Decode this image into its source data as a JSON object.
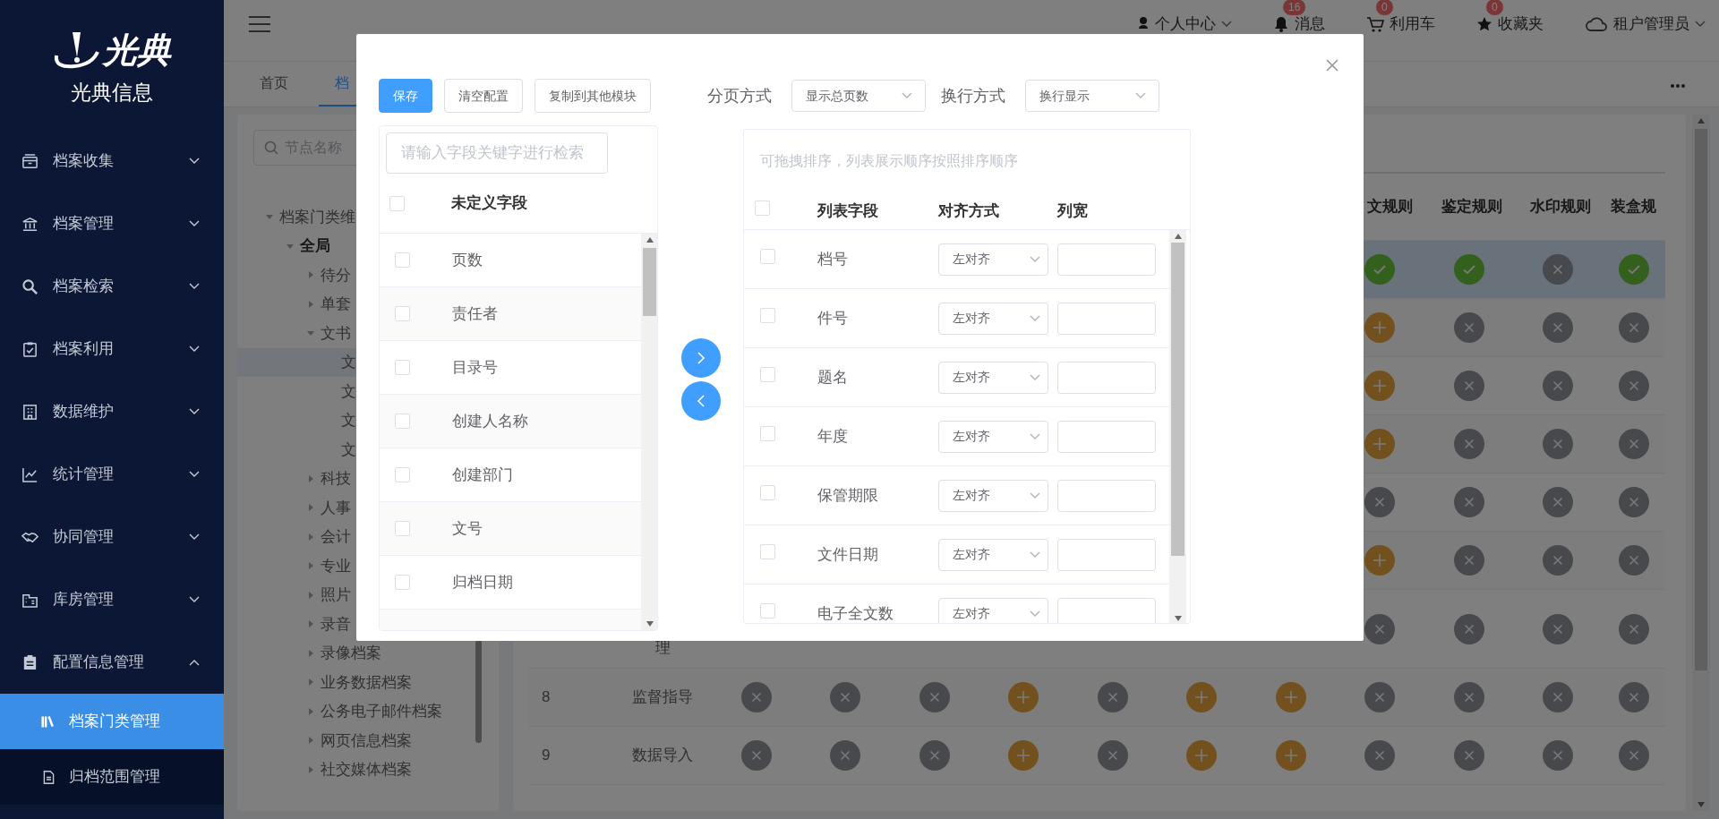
{
  "sidebar": {
    "logo_text": "光典",
    "brand": "光典信息",
    "items": [
      {
        "label": "档案收集",
        "expanded": false
      },
      {
        "label": "档案管理",
        "expanded": false
      },
      {
        "label": "档案检索",
        "expanded": false
      },
      {
        "label": "档案利用",
        "expanded": false
      },
      {
        "label": "数据维护",
        "expanded": false
      },
      {
        "label": "统计管理",
        "expanded": false
      },
      {
        "label": "协同管理",
        "expanded": false
      },
      {
        "label": "库房管理",
        "expanded": false
      },
      {
        "label": "配置信息管理",
        "expanded": true,
        "children": [
          {
            "label": "档案门类管理",
            "selected": true
          },
          {
            "label": "归档范围管理",
            "selected": false
          }
        ]
      }
    ]
  },
  "header": {
    "items": [
      {
        "kind": "dropdown",
        "label": "个人中心"
      },
      {
        "kind": "badge",
        "label": "消息",
        "badge": "16"
      },
      {
        "kind": "badge",
        "label": "利用车",
        "badge": "0"
      },
      {
        "kind": "badge",
        "label": "收藏夹",
        "badge": "0"
      },
      {
        "kind": "dropdown",
        "label": "租户管理员"
      }
    ]
  },
  "tabs": [
    {
      "label": "首页",
      "selected": false
    },
    {
      "label": "档",
      "selected": true
    }
  ],
  "tree": {
    "search_placeholder": "节点名称",
    "nodes": [
      {
        "label": "档案门类维",
        "expanded": true,
        "selected": false,
        "children": [
          {
            "label": "全局",
            "expanded": true,
            "selected": false,
            "children": [
              {
                "label": "待分",
                "expanded": false,
                "selected": false
              },
              {
                "label": "单套",
                "expanded": false,
                "selected": false
              },
              {
                "label": "文书",
                "expanded": true,
                "selected": false,
                "children": [
                  {
                    "label": "文",
                    "selected": true
                  },
                  {
                    "label": "文",
                    "selected": false
                  },
                  {
                    "label": "文",
                    "selected": false
                  },
                  {
                    "label": "文",
                    "selected": false
                  }
                ]
              },
              {
                "label": "科技",
                "expanded": false,
                "selected": false
              },
              {
                "label": "人事",
                "expanded": false,
                "selected": false
              },
              {
                "label": "会计",
                "expanded": false,
                "selected": false
              },
              {
                "label": "专业",
                "expanded": false,
                "selected": false
              },
              {
                "label": "照片",
                "expanded": false,
                "selected": false
              },
              {
                "label": "录音",
                "expanded": false,
                "selected": false
              },
              {
                "label": "录像档案",
                "expanded": false,
                "selected": false
              },
              {
                "label": "业务数据档案",
                "expanded": false,
                "selected": false
              },
              {
                "label": "公务电子邮件档案",
                "expanded": false,
                "selected": false
              },
              {
                "label": "网页信息档案",
                "expanded": false,
                "selected": false
              },
              {
                "label": "社交媒体档案",
                "expanded": false,
                "selected": false
              }
            ]
          }
        ]
      }
    ]
  },
  "table": {
    "columns": [
      null,
      null,
      null,
      null,
      null,
      null,
      null,
      "文规则",
      "鉴定规则",
      "水印规则",
      "装盒规"
    ],
    "rows": [
      {
        "selected": true,
        "cells": [
          null,
          null,
          null,
          null,
          null,
          null,
          null,
          {
            "kind": "check"
          },
          {
            "kind": "check"
          },
          {
            "kind": "cross"
          },
          {
            "kind": "check"
          }
        ]
      },
      {
        "selected": false,
        "cells": [
          null,
          null,
          null,
          null,
          null,
          null,
          null,
          {
            "kind": "plus"
          },
          {
            "kind": "cross"
          },
          {
            "kind": "cross"
          },
          {
            "kind": "cross"
          }
        ]
      },
      {
        "selected": false,
        "cells": [
          null,
          null,
          null,
          null,
          null,
          null,
          null,
          {
            "kind": "plus"
          },
          {
            "kind": "cross"
          },
          {
            "kind": "cross"
          },
          {
            "kind": "cross"
          }
        ]
      },
      {
        "selected": false,
        "cells": [
          null,
          null,
          null,
          null,
          null,
          null,
          null,
          {
            "kind": "plus"
          },
          {
            "kind": "cross"
          },
          {
            "kind": "cross"
          },
          {
            "kind": "cross"
          }
        ]
      },
      {
        "selected": false,
        "cells": [
          null,
          null,
          null,
          null,
          null,
          null,
          null,
          {
            "kind": "cross"
          },
          {
            "kind": "cross"
          },
          {
            "kind": "cross"
          },
          {
            "kind": "cross"
          }
        ]
      },
      {
        "selected": false,
        "cells": [
          null,
          null,
          null,
          null,
          null,
          null,
          null,
          {
            "kind": "plus"
          },
          {
            "kind": "cross"
          },
          {
            "kind": "cross"
          },
          {
            "kind": "cross"
          }
        ]
      },
      {
        "selected": false,
        "name": "理",
        "cells": [
          null,
          null,
          null,
          null,
          null,
          null,
          null,
          {
            "kind": "cross"
          },
          {
            "kind": "cross"
          },
          {
            "kind": "cross"
          },
          {
            "kind": "cross"
          }
        ]
      },
      {
        "selected": false,
        "number": "8",
        "name": "监督指导",
        "cells": [
          {
            "kind": "cross"
          },
          {
            "kind": "cross"
          },
          {
            "kind": "cross"
          },
          {
            "kind": "plus"
          },
          {
            "kind": "cross"
          },
          {
            "kind": "plus"
          },
          {
            "kind": "plus"
          },
          {
            "kind": "cross"
          },
          {
            "kind": "cross"
          },
          {
            "kind": "cross"
          },
          {
            "kind": "cross"
          }
        ]
      },
      {
        "selected": false,
        "number": "9",
        "name": "数据导入",
        "cells": [
          {
            "kind": "cross"
          },
          {
            "kind": "cross"
          },
          {
            "kind": "cross"
          },
          {
            "kind": "plus"
          },
          {
            "kind": "cross"
          },
          {
            "kind": "plus"
          },
          {
            "kind": "plus"
          },
          {
            "kind": "cross"
          },
          {
            "kind": "cross"
          },
          {
            "kind": "cross"
          },
          {
            "kind": "cross"
          }
        ]
      }
    ]
  },
  "dialog": {
    "buttons": [
      {
        "kind": "primary",
        "label": "保存"
      },
      {
        "kind": "default",
        "label": "清空配置"
      },
      {
        "kind": "default",
        "label": "复制到其他模块"
      }
    ],
    "options": [
      {
        "label": "分页方式",
        "value": "显示总页数"
      },
      {
        "label": "换行方式",
        "value": "换行显示"
      }
    ],
    "available": {
      "search_placeholder": "请输入字段关键字进行检索",
      "header": "未定义字段",
      "all_checked": false,
      "items": [
        {
          "label": "页数",
          "checked": false
        },
        {
          "label": "责任者",
          "checked": false
        },
        {
          "label": "目录号",
          "checked": false
        },
        {
          "label": "创建人名称",
          "checked": false
        },
        {
          "label": "创建部门",
          "checked": false
        },
        {
          "label": "文号",
          "checked": false
        },
        {
          "label": "归档日期",
          "checked": false
        }
      ]
    },
    "chosen": {
      "hint": "可拖拽排序，列表展示顺序按照排序顺序",
      "columns": [
        "列表字段",
        "对齐方式",
        "列宽"
      ],
      "all_checked": false,
      "rows": [
        {
          "label": "档号",
          "checked": false,
          "align": "左对齐"
        },
        {
          "label": "件号",
          "checked": false,
          "align": "左对齐"
        },
        {
          "label": "题名",
          "checked": false,
          "align": "左对齐"
        },
        {
          "label": "年度",
          "checked": false,
          "align": "左对齐"
        },
        {
          "label": "保管期限",
          "checked": false,
          "align": "左对齐"
        },
        {
          "label": "文件日期",
          "checked": false,
          "align": "左对齐"
        },
        {
          "label": "电子全文数",
          "checked": false,
          "align": "左对齐"
        }
      ]
    }
  }
}
